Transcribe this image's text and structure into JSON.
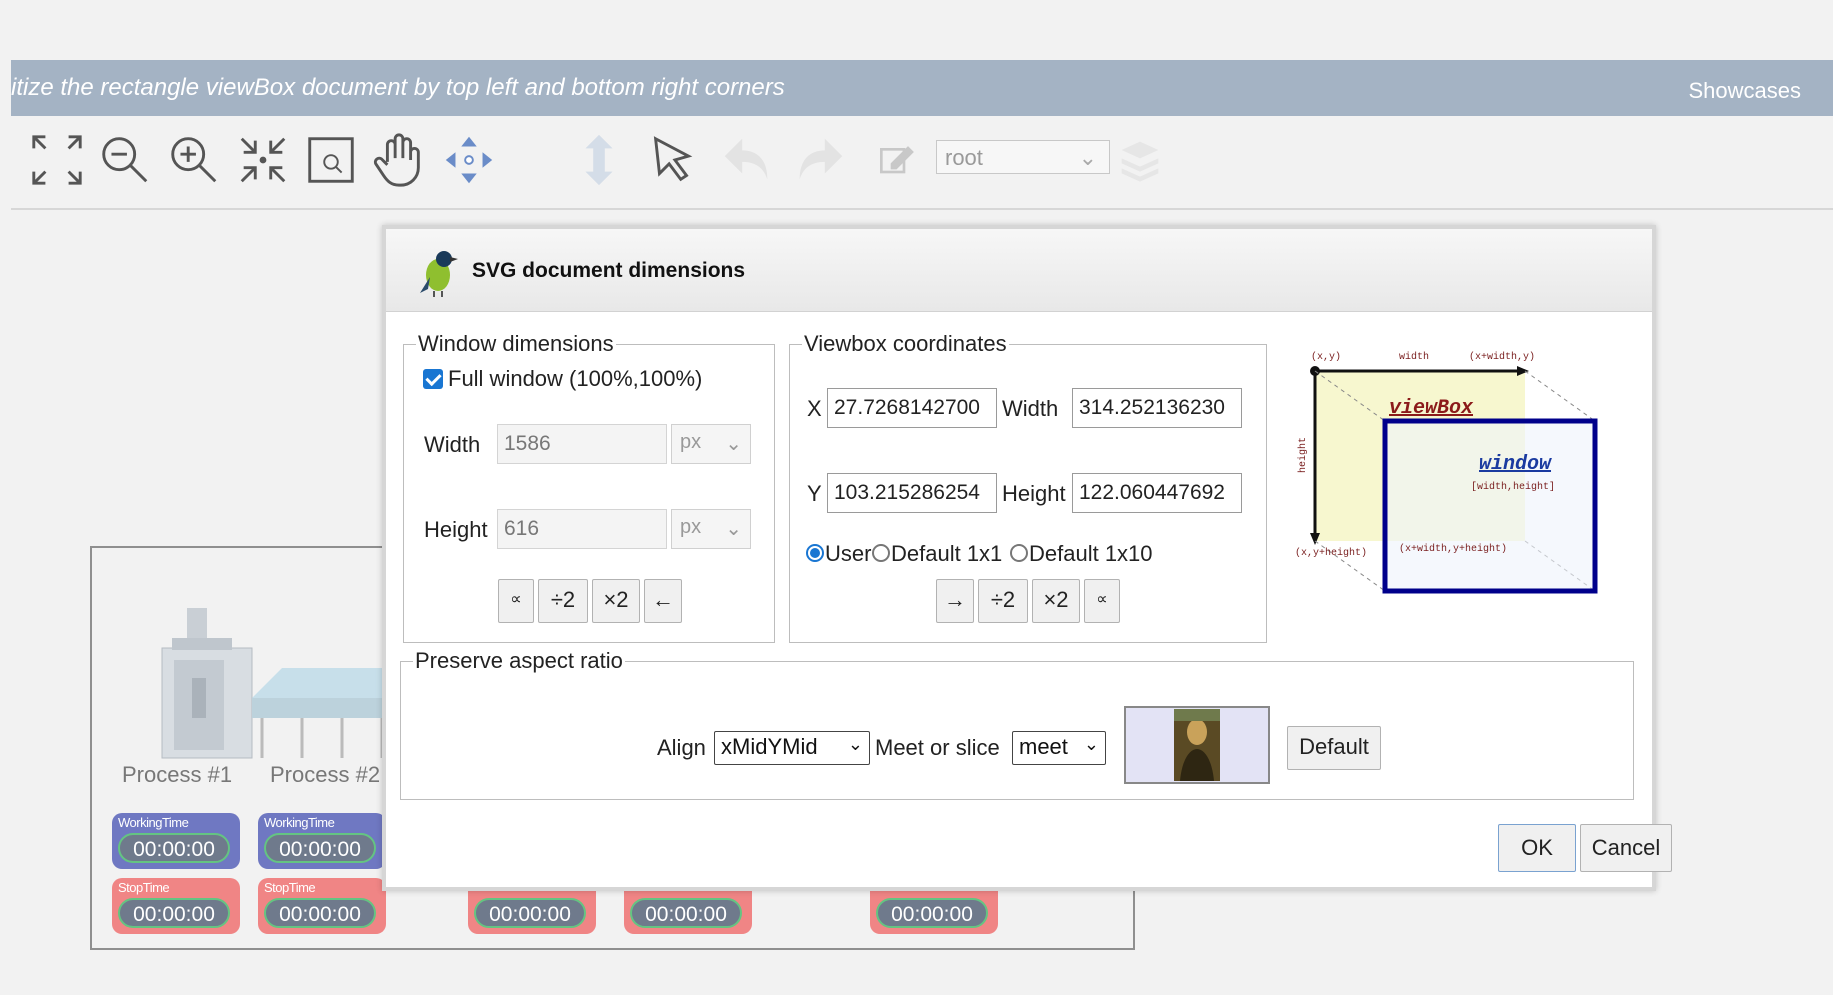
{
  "header": {
    "title": "itize the rectangle viewBox document by top left and bottom right corners",
    "showcases": "Showcases"
  },
  "toolbar": {
    "icons": [
      "fit-to-screen-icon",
      "zoom-out-icon",
      "zoom-in-icon",
      "collapse-icon",
      "zoom-region-icon",
      "pan-hand-icon",
      "move-arrows-icon",
      "vertical-resize-icon",
      "pointer-icon",
      "undo-icon",
      "redo-icon",
      "edit-icon",
      "layers-icon"
    ],
    "layer_select": "root"
  },
  "diagram": {
    "processes": [
      "Process #1",
      "Process #2"
    ],
    "working_label": "WorkingTime",
    "stop_label": "StopTime",
    "time_value": "00:00:00"
  },
  "dialog": {
    "title": "SVG document dimensions",
    "window_dimensions": {
      "legend": "Window dimensions",
      "full_window_label": "Full window (100%,100%)",
      "full_window_checked": true,
      "width_label": "Width",
      "width_value": "1586",
      "height_label": "Height",
      "height_value": "616",
      "unit": "px",
      "buttons": [
        "∝",
        "÷2",
        "×2",
        "←"
      ]
    },
    "viewbox": {
      "legend": "Viewbox coordinates",
      "x_label": "X",
      "x_value": "27.7268142700",
      "width_label": "Width",
      "width_value": "314.252136230",
      "y_label": "Y",
      "y_value": "103.215286254",
      "height_label": "Height",
      "height_value": "122.060447692",
      "radio_options": [
        "User",
        "Default 1x1",
        "Default 1x10"
      ],
      "selected_radio": "User",
      "buttons": [
        "→",
        "÷2",
        "×2",
        "∝"
      ]
    },
    "illustration": {
      "xy": "(x,y)",
      "width": "width",
      "xw_y": "(x+width,y)",
      "viewbox": "viewBox",
      "height": "height",
      "window": "window",
      "wh": "[width,height]",
      "x_yh": "(x,y+height)",
      "xw_yh": "(x+width,y+height)"
    },
    "aspect": {
      "legend": "Preserve aspect ratio",
      "align_label": "Align",
      "align_value": "xMidYMid",
      "meet_label": "Meet or slice",
      "meet_value": "meet",
      "default_button": "Default"
    },
    "ok": "OK",
    "cancel": "Cancel"
  }
}
